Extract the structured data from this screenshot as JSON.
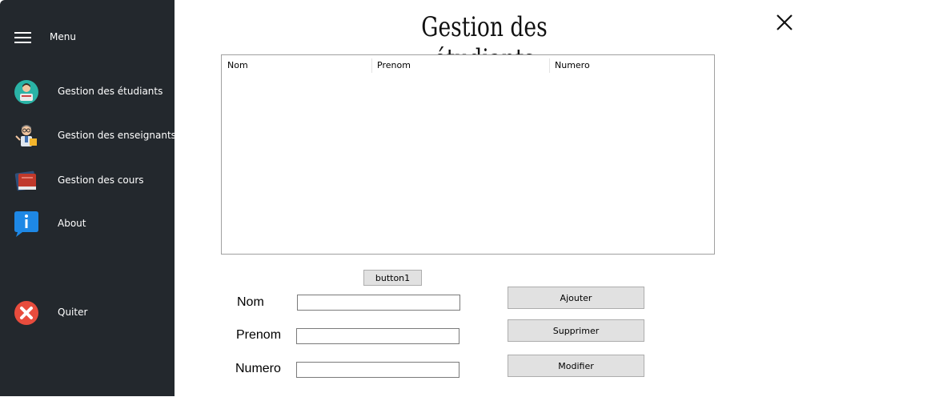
{
  "sidebar": {
    "menu_label": "Menu",
    "items": [
      {
        "label": "Gestion des étudiants",
        "icon": "student-icon"
      },
      {
        "label": "Gestion des enseignants",
        "icon": "teacher-icon"
      },
      {
        "label": "Gestion des cours",
        "icon": "books-icon"
      },
      {
        "label": "About",
        "icon": "info-icon"
      },
      {
        "label": "Quiter",
        "icon": "quit-icon"
      }
    ]
  },
  "header": {
    "title": "Gestion des étudiants"
  },
  "table": {
    "columns": [
      "Nom",
      "Prenom",
      "Numero"
    ],
    "rows": []
  },
  "form": {
    "button1_label": "button1",
    "fields": [
      {
        "label": "Nom",
        "value": ""
      },
      {
        "label": "Prenom",
        "value": ""
      },
      {
        "label": "Numero",
        "value": ""
      }
    ],
    "actions": {
      "add": "Ajouter",
      "delete": "Supprimer",
      "edit": "Modifier"
    }
  },
  "colors": {
    "sidebar_bg": "#23282d",
    "button_bg": "#e1e1e1",
    "quit_red": "#e84c3d",
    "info_blue": "#1e88e5"
  }
}
